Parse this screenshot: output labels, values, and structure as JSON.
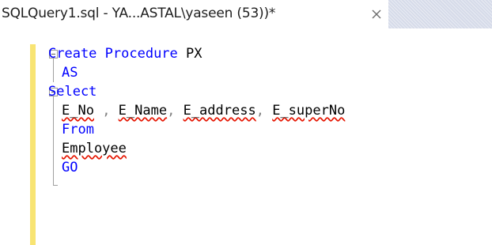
{
  "tab": {
    "title": "SQLQuery1.sql - YA...ASTAL\\yaseen (53))*",
    "close_icon": "close-icon"
  },
  "editor": {
    "lines": [
      {
        "segments": [
          {
            "text": "Create ",
            "kind": "keyword"
          },
          {
            "text": "Procedure",
            "kind": "keyword"
          },
          {
            "text": " PX",
            "kind": "identifier"
          }
        ]
      },
      {
        "segments": [
          {
            "text": "AS",
            "kind": "keyword"
          }
        ]
      },
      {
        "segments": [
          {
            "text": "Select",
            "kind": "keyword"
          }
        ]
      },
      {
        "segments": [
          {
            "text": "E_No",
            "kind": "identifier",
            "error": true
          },
          {
            "text": " , ",
            "kind": "operator"
          },
          {
            "text": "E_Name",
            "kind": "identifier",
            "error": true
          },
          {
            "text": ", ",
            "kind": "operator"
          },
          {
            "text": "E_address",
            "kind": "identifier",
            "error": true
          },
          {
            "text": ", ",
            "kind": "operator"
          },
          {
            "text": "E_superNo",
            "kind": "identifier",
            "error": true
          }
        ]
      },
      {
        "segments": [
          {
            "text": "From",
            "kind": "keyword"
          }
        ]
      },
      {
        "segments": [
          {
            "text": "Employee",
            "kind": "identifier",
            "error": true
          }
        ]
      },
      {
        "segments": [
          {
            "text": "GO",
            "kind": "keyword"
          }
        ]
      }
    ],
    "colors": {
      "keyword": "#0000ff",
      "identifier": "#000000",
      "operator": "#808080",
      "error_underline": "#e51400",
      "change_bar": "#f8e473"
    }
  }
}
